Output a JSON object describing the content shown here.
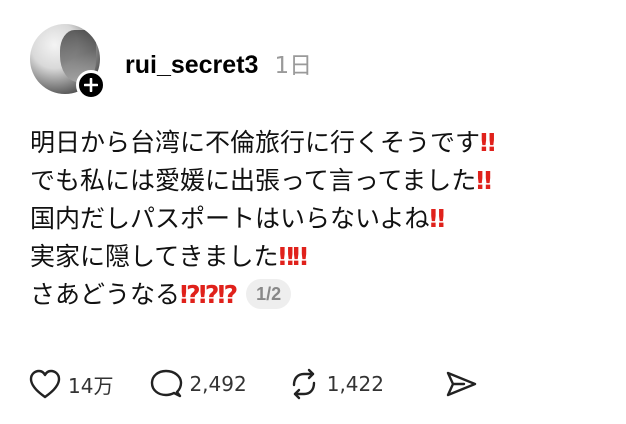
{
  "post": {
    "username": "rui_secret3",
    "time": "1日",
    "lines": [
      {
        "text": "明日から台湾に不倫旅行に行くそうです",
        "mark": "‼"
      },
      {
        "text": "でも私には愛媛に出張って言ってました",
        "mark": "‼"
      },
      {
        "text": "国内だしパスポートはいらないよね",
        "mark": "‼"
      },
      {
        "text": "実家に隠してきました",
        "mark": "‼‼"
      },
      {
        "text": "さあどうなる",
        "mark": "⁉⁉⁉"
      }
    ],
    "page_indicator": "1/2"
  },
  "actions": {
    "likes": "14万",
    "replies": "2,492",
    "reposts": "1,422"
  },
  "icons": {
    "follow": "plus-icon",
    "like": "heart-icon",
    "reply": "comment-icon",
    "repost": "repost-icon",
    "share": "send-icon"
  },
  "colors": {
    "mark_red": "#e0211b",
    "time_gray": "#9a9a9a",
    "pill_bg": "#eeeeee"
  }
}
